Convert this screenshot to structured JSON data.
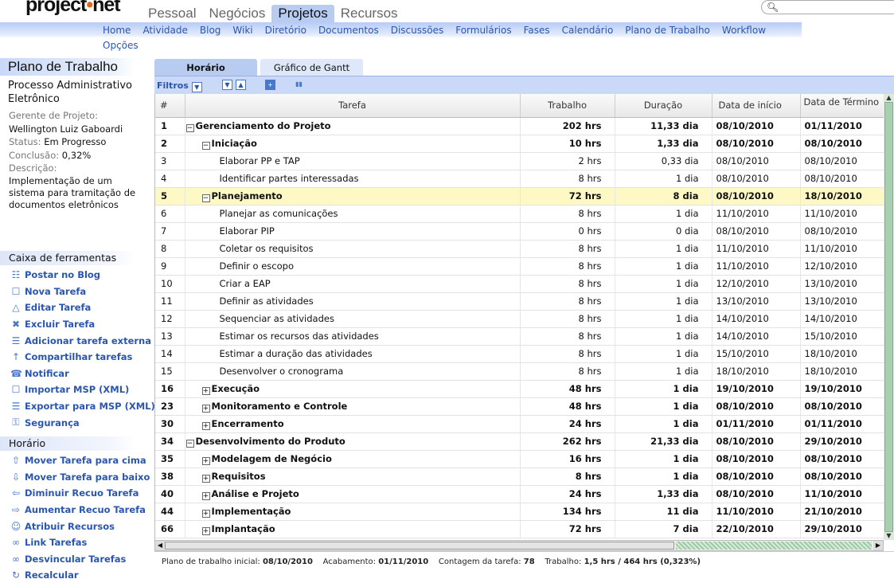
{
  "brand": {
    "part1": "project",
    "dot": "•",
    "part2": "net"
  },
  "topnav": [
    "Pessoal",
    "Negócios",
    "Projetos",
    "Recursos"
  ],
  "subnav": [
    "Home",
    "Atividade",
    "Blog",
    "Wiki",
    "Diretório",
    "Documentos",
    "Discussões",
    "Formulários",
    "Fases",
    "Calendário",
    "Plano de Trabalho",
    "Workflow"
  ],
  "subnav_extra": "Opções",
  "side": {
    "title": "Plano de Trabalho",
    "project": "Processo Administrativo Eletrônico",
    "manager_label": "Gerente de Projeto:",
    "manager": "Wellington Luiz Gaboardi",
    "status_label": "Status:",
    "status": "Em Progresso",
    "conclusion_label": "Conclusão:",
    "conclusion": "0,32%",
    "description_label": "Descrição:",
    "description": "Implementação de um sistema para tramitação de documentos eletrônicos"
  },
  "toolbox": {
    "title": "Caixa de ferramentas",
    "items": [
      "Postar no Blog",
      "Nova Tarefa",
      "Editar Tarefa",
      "Excluir Tarefa",
      "Adicionar tarefa externa",
      "Compartilhar tarefas",
      "Notificar",
      "Importar MSP (XML)",
      "Exportar para MSP (XML)",
      "Segurança"
    ]
  },
  "schedule": {
    "title": "Horário",
    "items": [
      "Mover Tarefa para cima",
      "Mover Tarefa para baixo",
      "Diminuir Recuo Tarefa",
      "Aumentar Recuo Tarefa",
      "Atribuir Recursos",
      "Link Tarefas",
      "Desvincular Tarefas",
      "Recalcular"
    ]
  },
  "tabs": [
    "Horário",
    "Gráfico de Gantt"
  ],
  "filters": "Filtros",
  "columns": [
    "#",
    "Tarefa",
    "Trabalho",
    "Duração",
    "Data de início",
    "Data de Término"
  ],
  "rows": [
    {
      "n": "1",
      "task": "Gerenciamento do Projeto",
      "work": "202 hrs",
      "dur": "11,33 dia",
      "start": "08/10/2010",
      "end": "01/11/2010",
      "lvl": 0,
      "bold": true,
      "tog": "−"
    },
    {
      "n": "2",
      "task": "Iniciação",
      "work": "10 hrs",
      "dur": "1,33 dia",
      "start": "08/10/2010",
      "end": "08/10/2010",
      "lvl": 1,
      "bold": true,
      "tog": "−"
    },
    {
      "n": "3",
      "task": "Elaborar PP e TAP",
      "work": "2 hrs",
      "dur": "0,33 dia",
      "start": "08/10/2010",
      "end": "08/10/2010",
      "lvl": 2,
      "bold": false
    },
    {
      "n": "4",
      "task": "Identificar partes interessadas",
      "work": "8 hrs",
      "dur": "1 dia",
      "start": "08/10/2010",
      "end": "08/10/2010",
      "lvl": 2,
      "bold": false
    },
    {
      "n": "5",
      "task": "Planejamento",
      "work": "72 hrs",
      "dur": "8 dia",
      "start": "08/10/2010",
      "end": "18/10/2010",
      "lvl": 1,
      "bold": true,
      "tog": "−",
      "hl": true
    },
    {
      "n": "6",
      "task": "Planejar as comunicações",
      "work": "8 hrs",
      "dur": "1 dia",
      "start": "11/10/2010",
      "end": "11/10/2010",
      "lvl": 2,
      "bold": false
    },
    {
      "n": "7",
      "task": "Elaborar PIP",
      "work": "0 hrs",
      "dur": "0 dia",
      "start": "08/10/2010",
      "end": "08/10/2010",
      "lvl": 2,
      "bold": false
    },
    {
      "n": "8",
      "task": "Coletar os requisitos",
      "work": "8 hrs",
      "dur": "1 dia",
      "start": "11/10/2010",
      "end": "11/10/2010",
      "lvl": 2,
      "bold": false
    },
    {
      "n": "9",
      "task": "Definir o escopo",
      "work": "8 hrs",
      "dur": "1 dia",
      "start": "11/10/2010",
      "end": "12/10/2010",
      "lvl": 2,
      "bold": false
    },
    {
      "n": "10",
      "task": "Criar a EAP",
      "work": "8 hrs",
      "dur": "1 dia",
      "start": "12/10/2010",
      "end": "13/10/2010",
      "lvl": 2,
      "bold": false
    },
    {
      "n": "11",
      "task": "Definir as atividades",
      "work": "8 hrs",
      "dur": "1 dia",
      "start": "13/10/2010",
      "end": "13/10/2010",
      "lvl": 2,
      "bold": false
    },
    {
      "n": "12",
      "task": "Sequenciar as atividades",
      "work": "8 hrs",
      "dur": "1 dia",
      "start": "14/10/2010",
      "end": "14/10/2010",
      "lvl": 2,
      "bold": false
    },
    {
      "n": "13",
      "task": "Estimar os recursos das atividades",
      "work": "8 hrs",
      "dur": "1 dia",
      "start": "14/10/2010",
      "end": "15/10/2010",
      "lvl": 2,
      "bold": false
    },
    {
      "n": "14",
      "task": "Estimar a duração das atividades",
      "work": "8 hrs",
      "dur": "1 dia",
      "start": "15/10/2010",
      "end": "18/10/2010",
      "lvl": 2,
      "bold": false
    },
    {
      "n": "15",
      "task": "Desenvolver o cronograma",
      "work": "8 hrs",
      "dur": "1 dia",
      "start": "18/10/2010",
      "end": "18/10/2010",
      "lvl": 2,
      "bold": false
    },
    {
      "n": "16",
      "task": "Execução",
      "work": "48 hrs",
      "dur": "1 dia",
      "start": "19/10/2010",
      "end": "19/10/2010",
      "lvl": 1,
      "bold": true,
      "tog": "+"
    },
    {
      "n": "23",
      "task": "Monitoramento e Controle",
      "work": "48 hrs",
      "dur": "1 dia",
      "start": "08/10/2010",
      "end": "08/10/2010",
      "lvl": 1,
      "bold": true,
      "tog": "+"
    },
    {
      "n": "30",
      "task": "Encerramento",
      "work": "24 hrs",
      "dur": "1 dia",
      "start": "01/11/2010",
      "end": "01/11/2010",
      "lvl": 1,
      "bold": true,
      "tog": "+"
    },
    {
      "n": "34",
      "task": "Desenvolvimento do Produto",
      "work": "262 hrs",
      "dur": "21,33 dia",
      "start": "08/10/2010",
      "end": "29/10/2010",
      "lvl": 0,
      "bold": true,
      "tog": "−"
    },
    {
      "n": "35",
      "task": "Modelagem de Negócio",
      "work": "16 hrs",
      "dur": "1 dia",
      "start": "08/10/2010",
      "end": "08/10/2010",
      "lvl": 1,
      "bold": true,
      "tog": "+"
    },
    {
      "n": "38",
      "task": "Requisitos",
      "work": "8 hrs",
      "dur": "1 dia",
      "start": "08/10/2010",
      "end": "08/10/2010",
      "lvl": 1,
      "bold": true,
      "tog": "+"
    },
    {
      "n": "40",
      "task": "Análise e Projeto",
      "work": "24 hrs",
      "dur": "1,33 dia",
      "start": "08/10/2010",
      "end": "11/10/2010",
      "lvl": 1,
      "bold": true,
      "tog": "+"
    },
    {
      "n": "44",
      "task": "Implementação",
      "work": "134 hrs",
      "dur": "11 dia",
      "start": "11/10/2010",
      "end": "21/10/2010",
      "lvl": 1,
      "bold": true,
      "tog": "+"
    },
    {
      "n": "66",
      "task": "Implantação",
      "work": "72 hrs",
      "dur": "7 dia",
      "start": "22/10/2010",
      "end": "29/10/2010",
      "lvl": 1,
      "bold": true,
      "tog": "+"
    }
  ],
  "footer": {
    "start_label": "Plano de trabalho inicial:",
    "start": "08/10/2010",
    "end_label": "Acabamento:",
    "end": "01/11/2010",
    "count_label": "Contagem da tarefa:",
    "count": "78",
    "work_label": "Trabalho:",
    "work": "1,5 hrs / 464 hrs (0,323%)"
  }
}
